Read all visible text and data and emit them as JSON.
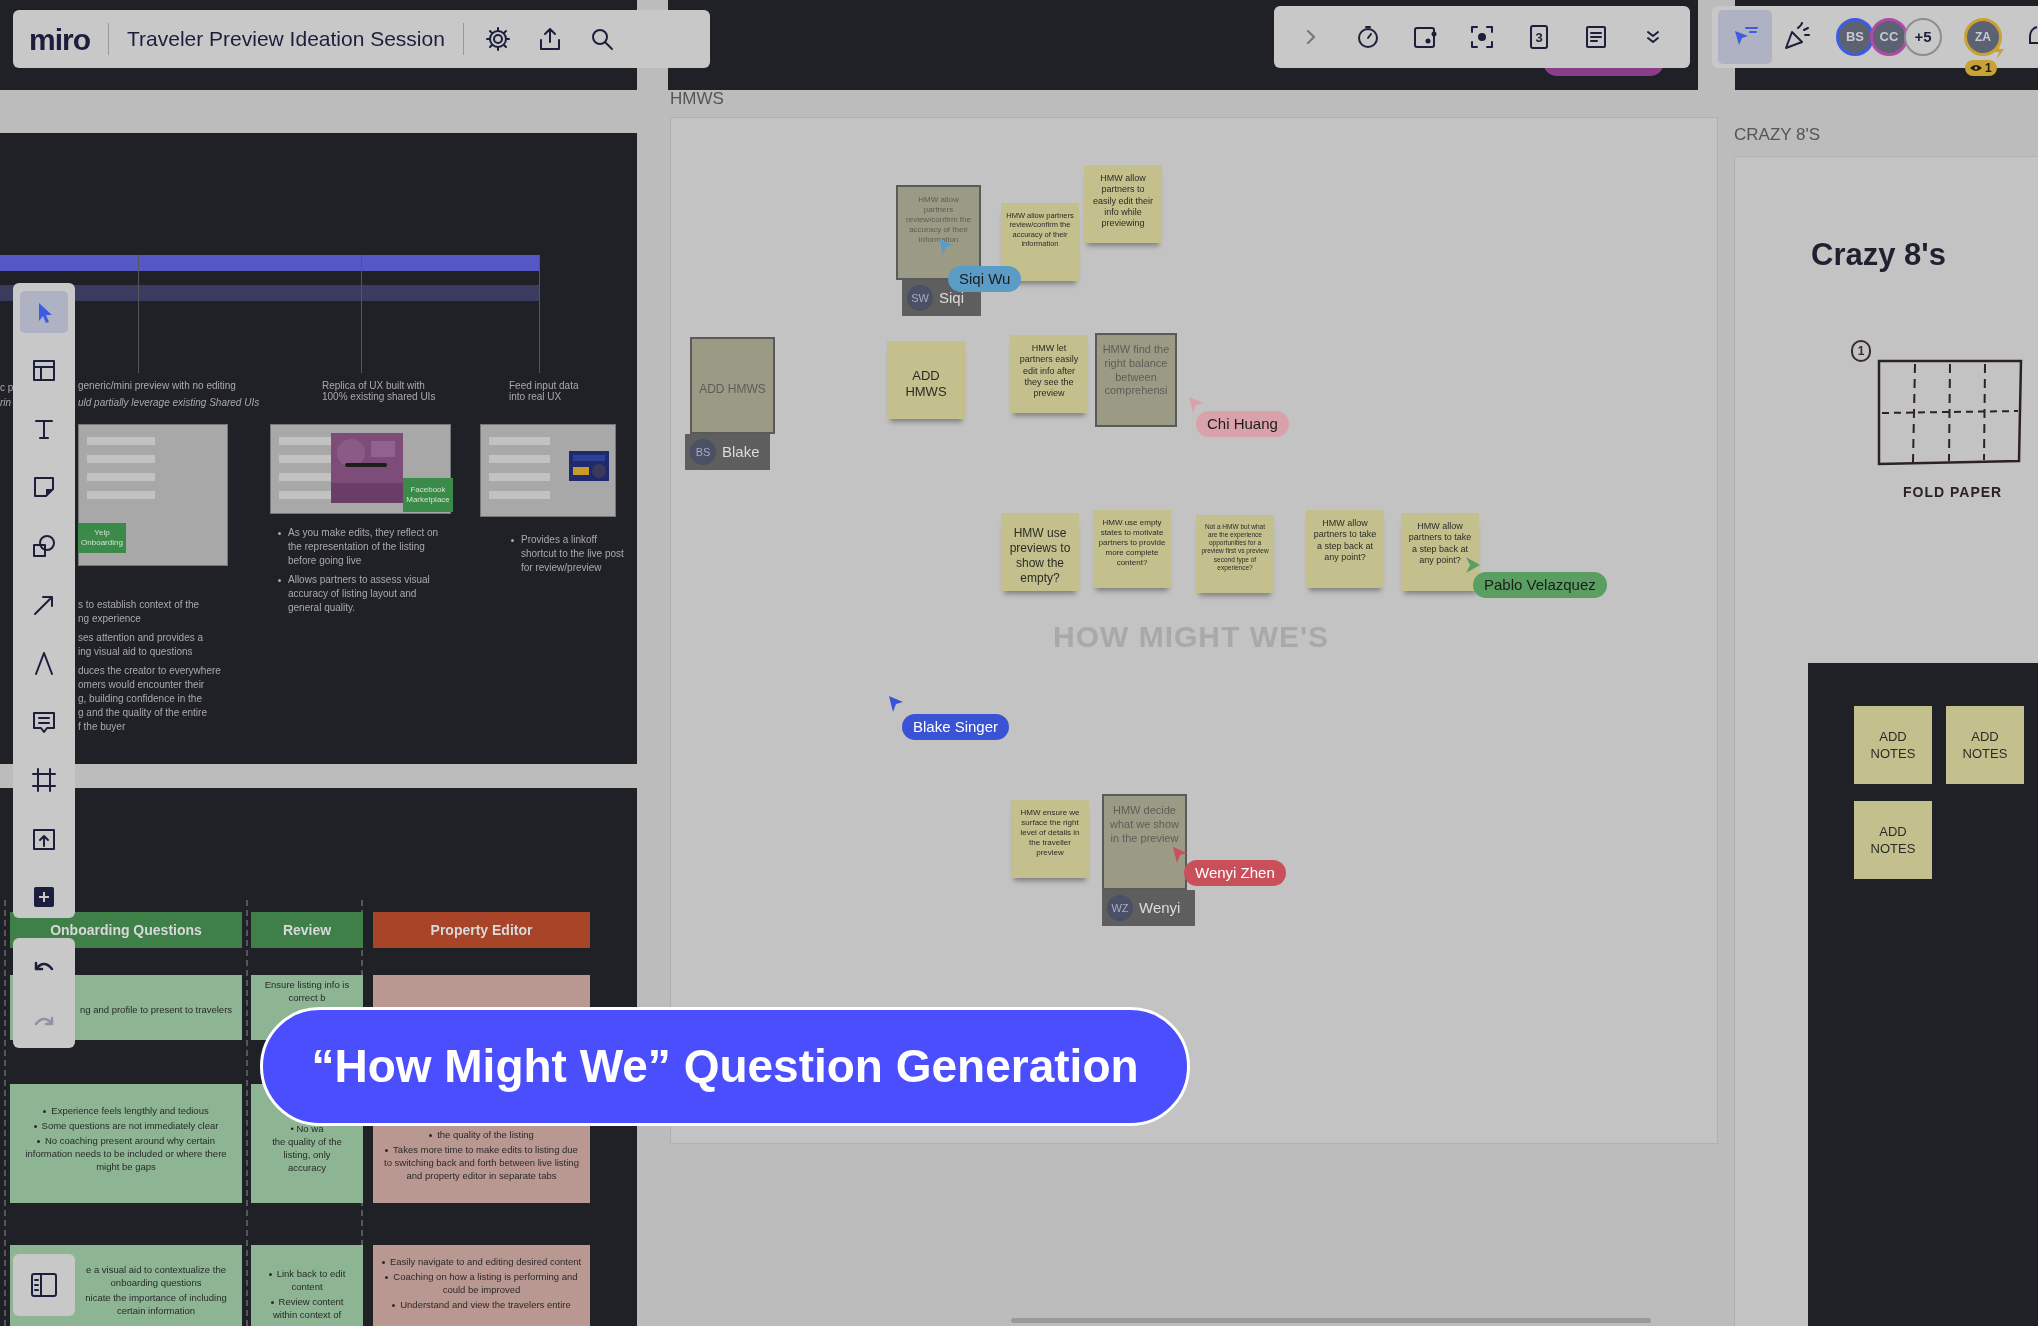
{
  "header": {
    "logo": "miro",
    "board_title": "Traveler Preview Ideation Session"
  },
  "top_toolbar": {
    "card_number": "3"
  },
  "collaborators": {
    "avatars": [
      {
        "initials": "BS",
        "color": "#3d5ce0"
      },
      {
        "initials": "CC",
        "color": "#b04aa6"
      }
    ],
    "more": "+5",
    "me": {
      "initials": "ZA"
    },
    "viewers": "1"
  },
  "left_toolbar": {
    "tools": [
      {
        "kind": "select",
        "selected": true
      },
      {
        "kind": "templates",
        "selected": false
      },
      {
        "kind": "text",
        "selected": false
      },
      {
        "kind": "sticky",
        "selected": false
      },
      {
        "kind": "shapes",
        "selected": false
      },
      {
        "kind": "line",
        "selected": false
      },
      {
        "kind": "pen",
        "selected": false
      },
      {
        "kind": "comment",
        "selected": false
      },
      {
        "kind": "frame",
        "selected": false
      },
      {
        "kind": "upload",
        "selected": false
      },
      {
        "kind": "more",
        "selected": false
      }
    ],
    "undo": {
      "disabled": false
    },
    "redo": {
      "disabled": true
    }
  },
  "frames": [
    {
      "label": "HMWS"
    },
    {
      "label": "CRAZY 8'S"
    }
  ],
  "research_panel": {
    "fragments": [
      "c p",
      "rin"
    ],
    "columns": [
      {
        "caption": "generic/mini preview with no editing",
        "subcaption": "uld partially leverage existing Shared UIs",
        "badge": "Yelp Onboarding",
        "points": [
          "s to establish context of the\nng experience",
          "ses attention and provides a\ning visual aid to questions",
          "duces the creator to everywhere\nomers would encounter their\ng, building confidence in the\ng and the quality of the entire\nf the buyer"
        ]
      },
      {
        "caption": "Replica of UX built with\n100% existing shared UIs",
        "badge": "Facebook Marketplace",
        "points": [
          "As you make edits, they reflect on the representation of the listing before going live",
          "Allows partners to assess visual accuracy of listing layout and general quality."
        ]
      },
      {
        "caption": "Feed input data\ninto real UX",
        "points": [
          "Provides a linkoff shortcut to the live post for review/preview"
        ]
      }
    ]
  },
  "hmw_board": {
    "heading": "HOW MIGHT WE'S",
    "stickies": [
      {
        "text": "HMW allow partners review/confirm the accuracy of their information",
        "editing": true,
        "editor": {
          "initials": "SW",
          "name": "Siqi"
        }
      },
      {
        "text": "HMW allow partners review/confirm the accuracy of their information",
        "editing": false
      },
      {
        "text": "HMW allow partners to easily edit their info while previewing",
        "editing": false
      },
      {
        "text": "ADD HMWS",
        "editing": true,
        "editor": {
          "initials": "BS",
          "name": "Blake"
        }
      },
      {
        "text": "ADD HMWS",
        "editing": false
      },
      {
        "text": "HMW let partners easily edit info after they see the preview",
        "editing": false
      },
      {
        "text": "HMW find the right balance between comprehensi",
        "editing": true
      },
      {
        "text": "HMW use previews to show the empty?",
        "editing": false
      },
      {
        "text": "HMW use empty states to motivate partners to provide more complete content?",
        "editing": false
      },
      {
        "text": "Not a HMW but what are the experience opportunities for a preview first vs preview second type of experience?",
        "editing": false
      },
      {
        "text": "HMW allow partners to take a step back at any point?",
        "editing": false
      },
      {
        "text": "HMW allow partners to take a step back at any point?",
        "editing": false
      },
      {
        "text": "HMW ensure we surface the right level of details in the traveller preview",
        "editing": false
      },
      {
        "text": "HMW decide what we show in the preview",
        "editing": true,
        "editor": {
          "initials": "WZ",
          "name": "Wenyi"
        }
      }
    ],
    "cursors": [
      {
        "name": "Siqi Wu",
        "color": "#5b9cc7"
      },
      {
        "name": "Chi Huang",
        "color": "#d9a2aa"
      },
      {
        "name": "Pablo Velazquez",
        "color": "#5a9e62"
      },
      {
        "name": "Blake Singer",
        "color": "#3a52d4"
      },
      {
        "name": "Wenyi Zhen",
        "color": "#c9505a"
      }
    ]
  },
  "crazy_eights": {
    "title": "Crazy 8's",
    "step": "1",
    "caption": "FOLD PAPER",
    "notes": [
      "ADD NOTES",
      "ADD NOTES",
      "ADD NOTES"
    ]
  },
  "journey_table": {
    "columns": [
      {
        "title": "Onboarding Questions",
        "color": "#3f8049",
        "cards": [
          {
            "bulleted": false,
            "lines": [
              "ng and profile to present to travelers"
            ]
          },
          {
            "bulleted": true,
            "lines": [
              "Experience feels lengthly and tedious",
              "Some questions are not immediately clear",
              "No coaching present around why certain information needs to be included or where there might be gaps"
            ]
          },
          {
            "bulleted": false,
            "lines": [
              "e a visual aid to contextualize the onboarding questions",
              "nicate the importance of including certain information"
            ]
          }
        ]
      },
      {
        "title": "Review",
        "color": "#3f8049",
        "cards": [
          {
            "bulleted": false,
            "lines": [
              "Ensure listing info is\ncorrect b"
            ]
          },
          {
            "bulleted": false,
            "lines": [
              "• No wa\nthe quality of the\nlisting, only\naccuracy"
            ]
          },
          {
            "bulleted": true,
            "lines": [
              "Link back to edit content",
              "Review content within context of"
            ]
          }
        ]
      },
      {
        "title": "Property Editor",
        "color": "#a84428",
        "cards": [
          {
            "bulleted": true,
            "lines": [
              "the quality of the listing",
              "Takes more time to make edits to listing due to switching back and forth between live listing and property editor in separate tabs"
            ]
          },
          {
            "bulleted": true,
            "lines": [
              "Easily navigate to and editing desired content",
              "Coaching on how a listing is performing and could be improved",
              "Understand and view the travelers entire"
            ]
          }
        ]
      }
    ]
  },
  "banner": "“How Might We” Question Generation"
}
